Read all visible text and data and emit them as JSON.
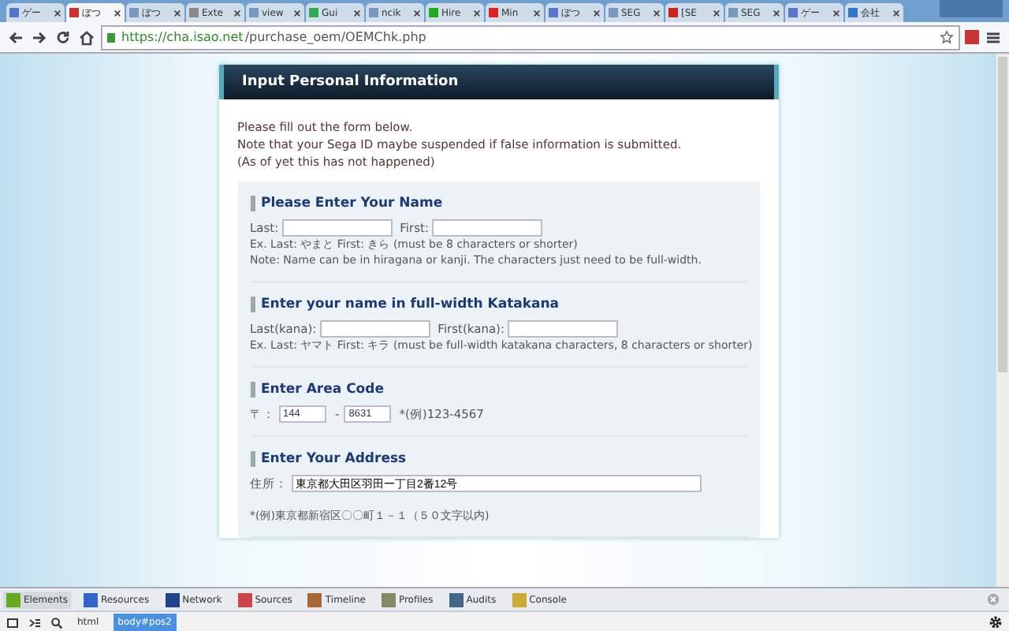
{
  "browser": {
    "tabs": [
      {
        "label": "ゲー",
        "selected": false
      },
      {
        "label": "ぼつ",
        "selected": true
      },
      {
        "label": "ぼつ",
        "selected": false
      },
      {
        "label": "Exte",
        "selected": false
      },
      {
        "label": "view",
        "selected": false
      },
      {
        "label": "Gui",
        "selected": false
      },
      {
        "label": "ncik",
        "selected": false
      },
      {
        "label": "Hire",
        "selected": false
      },
      {
        "label": "Min",
        "selected": false
      },
      {
        "label": "ぼつ",
        "selected": false
      },
      {
        "label": "SEG",
        "selected": false
      },
      {
        "label": "[SE",
        "selected": false
      },
      {
        "label": "SEG",
        "selected": false
      },
      {
        "label": "ゲー",
        "selected": false
      },
      {
        "label": "会社",
        "selected": false
      }
    ],
    "url_host": "https://cha.isao.net",
    "url_path": "/purchase_oem/OEMChk.php"
  },
  "panel": {
    "title": "Input Personal Information",
    "intro": [
      "Please fill out the form below.",
      "Note that your Sega ID maybe suspended if false information is submitted.",
      "(As of yet this has not happened)"
    ],
    "sections": [
      {
        "kind": "name",
        "heading": "Please Enter Your Name",
        "fields": [
          {
            "label": "Last:"
          },
          {
            "label": "First:"
          }
        ],
        "notes": [
          "Ex. Last: やまと First: きら (must be 8 characters or shorter)",
          "Note: Name can be in hiragana or kanji. The characters just need to be full-width."
        ]
      },
      {
        "kind": "name",
        "heading": "Enter your name in full-width Katakana",
        "fields": [
          {
            "label": "Last(kana):"
          },
          {
            "label": "First(kana):"
          }
        ],
        "notes": [
          "Ex. Last: ヤマト First: キラ (must be full-width katakana characters, 8 characters or shorter)"
        ]
      },
      {
        "kind": "postal",
        "heading": "Enter Area Code",
        "fields": [
          {
            "label": "〒：",
            "value": "144"
          },
          {
            "value": "8631"
          }
        ],
        "separator": "-",
        "notes": [
          "*(例)123-4567"
        ]
      },
      {
        "kind": "address",
        "heading": "Enter Your Address",
        "fields": [
          {
            "label": "住所：",
            "value": "東京都大田区羽田一丁目2番12号"
          }
        ],
        "notes": [
          "*(例)東京都新宿区〇〇町１－１（５０文字以内)"
        ]
      }
    ]
  },
  "devtools": {
    "tabs": [
      {
        "label": "Elements",
        "selected": true
      },
      {
        "label": "Resources",
        "selected": false
      },
      {
        "label": "Network",
        "selected": false
      },
      {
        "label": "Sources",
        "selected": false
      },
      {
        "label": "Timeline",
        "selected": false
      },
      {
        "label": "Profiles",
        "selected": false
      },
      {
        "label": "Audits",
        "selected": false
      },
      {
        "label": "Console",
        "selected": false
      }
    ],
    "breadcrumbs": [
      {
        "label": "html",
        "selected": false
      },
      {
        "label": "body#pos2",
        "selected": true
      }
    ]
  }
}
